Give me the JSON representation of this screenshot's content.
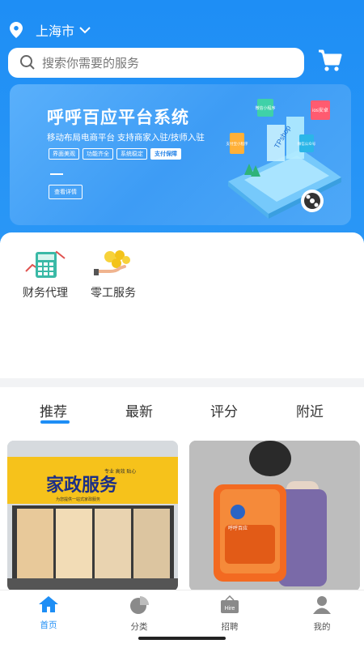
{
  "header": {
    "city": "上海市",
    "search_placeholder": "搜索你需要的服务"
  },
  "banner": {
    "title": "呼呼百应平台系统",
    "subtitle": "移动布局电商平台 支持商家入驻/技师入驻",
    "tags": [
      "界面美观",
      "功能齐全",
      "系统稳定",
      "支付保障"
    ],
    "button": "查看详情",
    "phone_text": "TPshop",
    "badges": [
      "微信小程序",
      "ios安卓",
      "支付宝小程序",
      "微信公众号"
    ]
  },
  "services": [
    {
      "label": "财务代理"
    },
    {
      "label": "零工服务"
    }
  ],
  "tabs": [
    "推荐",
    "最新",
    "评分",
    "附近"
  ],
  "cards": {
    "shop_sign": "家政服务",
    "shop_small": "专业 高效 贴心",
    "shop_slogan": "为您提供一站式家政服务",
    "backpack_text": "呼呼百应"
  },
  "bottom_nav": [
    {
      "label": "首页"
    },
    {
      "label": "分类"
    },
    {
      "label": "招聘"
    },
    {
      "label": "我的"
    }
  ],
  "colors": {
    "accent": "#1e8ef5",
    "yellow": "#f6c21b"
  }
}
